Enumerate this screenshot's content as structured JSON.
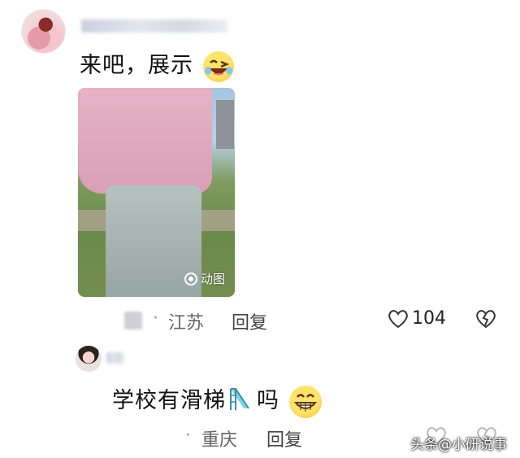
{
  "comments": [
    {
      "text": "来吧，展示",
      "emoji": "wink-laugh-emoji",
      "badge": "动图",
      "location": "江苏",
      "reply_label": "回复",
      "likes": "104"
    },
    {
      "text": "学校有滑梯",
      "text_tail": "吗",
      "emoji": "grin-emoji",
      "location": "重庆",
      "reply_label": "回复"
    }
  ],
  "watermark": "头条@小研说事",
  "separator_dot": "·",
  "colors": {
    "text": "#111111",
    "meta": "#666666",
    "background": "#ffffff"
  }
}
